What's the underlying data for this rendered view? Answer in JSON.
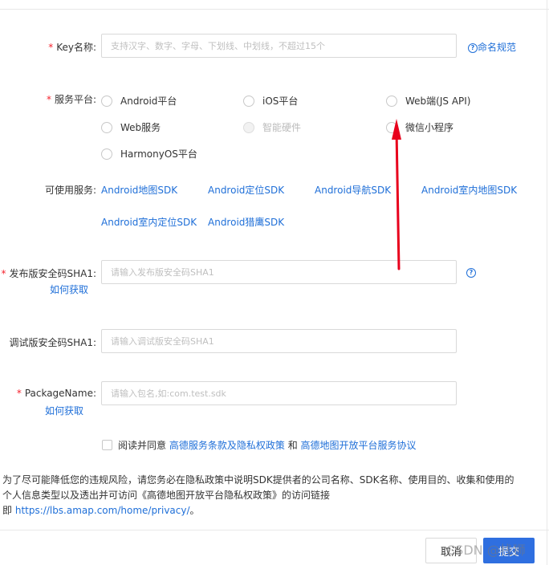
{
  "form": {
    "key_name": {
      "label": "Key名称:",
      "placeholder": "支持汉字、数字、字母、下划线、中划线，不超过15个",
      "help_link": "命名规范"
    },
    "platform": {
      "label": "服务平台:",
      "options": [
        {
          "label": "Android平台",
          "disabled": false
        },
        {
          "label": "iOS平台",
          "disabled": false
        },
        {
          "label": "Web端(JS API)",
          "disabled": false
        },
        {
          "label": "Web服务",
          "disabled": false
        },
        {
          "label": "智能硬件",
          "disabled": true
        },
        {
          "label": "微信小程序",
          "disabled": false
        },
        {
          "label": "HarmonyOS平台",
          "disabled": false
        }
      ]
    },
    "services": {
      "label": "可使用服务:",
      "items": [
        "Android地图SDK",
        "Android定位SDK",
        "Android导航SDK",
        "Android室内地图SDK",
        "Android室内定位SDK",
        "Android猎鹰SDK"
      ]
    },
    "release_sha1": {
      "label": "发布版安全码SHA1:",
      "placeholder": "请输入发布版安全码SHA1",
      "how_link": "如何获取"
    },
    "debug_sha1": {
      "label": "调试版安全码SHA1:",
      "placeholder": "请输入调试版安全码SHA1"
    },
    "package_name": {
      "label": "PackageName:",
      "placeholder": "请输入包名,如:com.test.sdk",
      "how_link": "如何获取"
    },
    "agreement": {
      "prefix": "阅读并同意",
      "link1": "高德服务条款及隐私权政策",
      "middle": "和",
      "link2": "高德地图开放平台服务协议"
    }
  },
  "notice": {
    "text": "为了尽可能降低您的违规风险，请您务必在隐私政策中说明SDK提供者的公司名称、SDK名称、使用目的、收集和使用的个人信息类型以及透出并可访问《高德地图开放平台隐私权政策》的访问链接即",
    "link": "https://lbs.amap.com/home/privacy/",
    "suffix": "。"
  },
  "footer": {
    "cancel_label": "取消",
    "submit_label": "提交"
  },
  "watermark": "CSDN @栈狮",
  "colors": {
    "link": "#1f6fd8",
    "required": "#f5222d",
    "primary": "#2f6fe0",
    "annotation_arrow": "#e8001c"
  },
  "icons": {
    "help": "question-circle-icon",
    "annotation": "red-arrow-up-icon"
  }
}
